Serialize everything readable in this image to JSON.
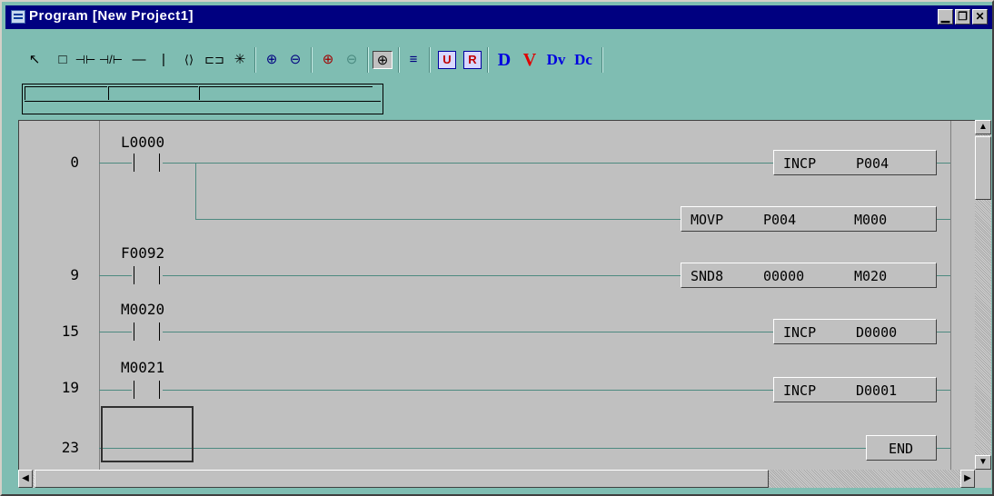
{
  "window": {
    "title": "Program [New Project1]",
    "buttons": {
      "minimize": "▁",
      "restore": "❐",
      "close": "✕"
    }
  },
  "toolbar": {
    "items": [
      {
        "name": "select-arrow-icon",
        "glyph": "↖"
      },
      {
        "name": "rectangle-icon",
        "glyph": "□"
      },
      {
        "name": "no-contact-icon",
        "glyph": "⊣⊢"
      },
      {
        "name": "nc-contact-icon",
        "glyph": "⊣/⊢"
      },
      {
        "name": "horizontal-line-icon",
        "glyph": "—"
      },
      {
        "name": "vertical-line-icon",
        "glyph": "|"
      },
      {
        "name": "coil-icon",
        "glyph": "⟨⟩"
      },
      {
        "name": "function-box-icon",
        "glyph": "⊏⊐"
      },
      {
        "name": "delete-icon",
        "glyph": "✳"
      },
      {
        "name": "zoom-in-icon",
        "glyph": "⊕"
      },
      {
        "name": "zoom-out-icon",
        "glyph": "⊖"
      },
      {
        "name": "zoom-in-red-icon",
        "glyph": "⊕"
      },
      {
        "name": "zoom-out-disabled-icon",
        "glyph": "⊖"
      },
      {
        "name": "zoom-toggle-icon",
        "glyph": "⊕"
      },
      {
        "name": "align-icon",
        "glyph": "≡"
      },
      {
        "name": "u-icon",
        "glyph": "U"
      },
      {
        "name": "r-icon",
        "glyph": "R"
      },
      {
        "name": "d-icon",
        "glyph": "D"
      },
      {
        "name": "v-icon",
        "glyph": "V"
      },
      {
        "name": "dv-icon",
        "glyph": "Dv"
      },
      {
        "name": "dc-icon",
        "glyph": "Dc"
      }
    ]
  },
  "ladder": {
    "rungs": [
      {
        "step": "0",
        "contact": "L0000",
        "instr": "INCP",
        "op1": "P004",
        "op2": ""
      },
      {
        "step": "",
        "contact": "",
        "instr": "MOVP",
        "op1": "P004",
        "op2": "M000"
      },
      {
        "step": "9",
        "contact": "F0092",
        "instr": "SND8",
        "op1": "00000",
        "op2": "M020"
      },
      {
        "step": "15",
        "contact": "M0020",
        "instr": "INCP",
        "op1": "D0000",
        "op2": ""
      },
      {
        "step": "19",
        "contact": "M0021",
        "instr": "INCP",
        "op1": "D0001",
        "op2": ""
      },
      {
        "step": "23",
        "contact": "",
        "instr": "END",
        "op1": "",
        "op2": ""
      }
    ]
  },
  "colors": {
    "titlebar": "#000080",
    "panel": "#7fbdb2",
    "editor": "#c0c0c0"
  }
}
